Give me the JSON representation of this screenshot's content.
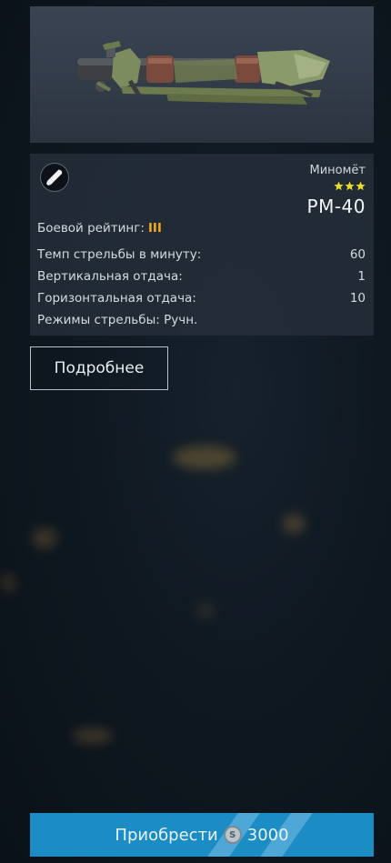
{
  "weapon": {
    "type": "Миномёт",
    "name": "PM-40",
    "rank_stars": 3,
    "battle_rating_label": "Боевой рейтинг:",
    "battle_rating_value": "III",
    "stats": [
      {
        "label": "Темп стрельбы в минуту:",
        "value": "60"
      },
      {
        "label": "Вертикальная отдача:",
        "value": "1"
      },
      {
        "label": "Горизонтальная отдача:",
        "value": "10"
      },
      {
        "label": "Режимы стрельбы: Ручн.",
        "value": ""
      }
    ]
  },
  "buttons": {
    "details_label": "Подробнее",
    "buy_label": "Приобрести",
    "price": "3000"
  },
  "colors": {
    "accent_blue": "#1b8cc4",
    "rating_orange": "#f0a81e",
    "star_yellow": "#e8dc2a"
  },
  "icons": {
    "type_icon": "mortar-shell-icon",
    "currency_icon": "silver-coin-icon"
  }
}
